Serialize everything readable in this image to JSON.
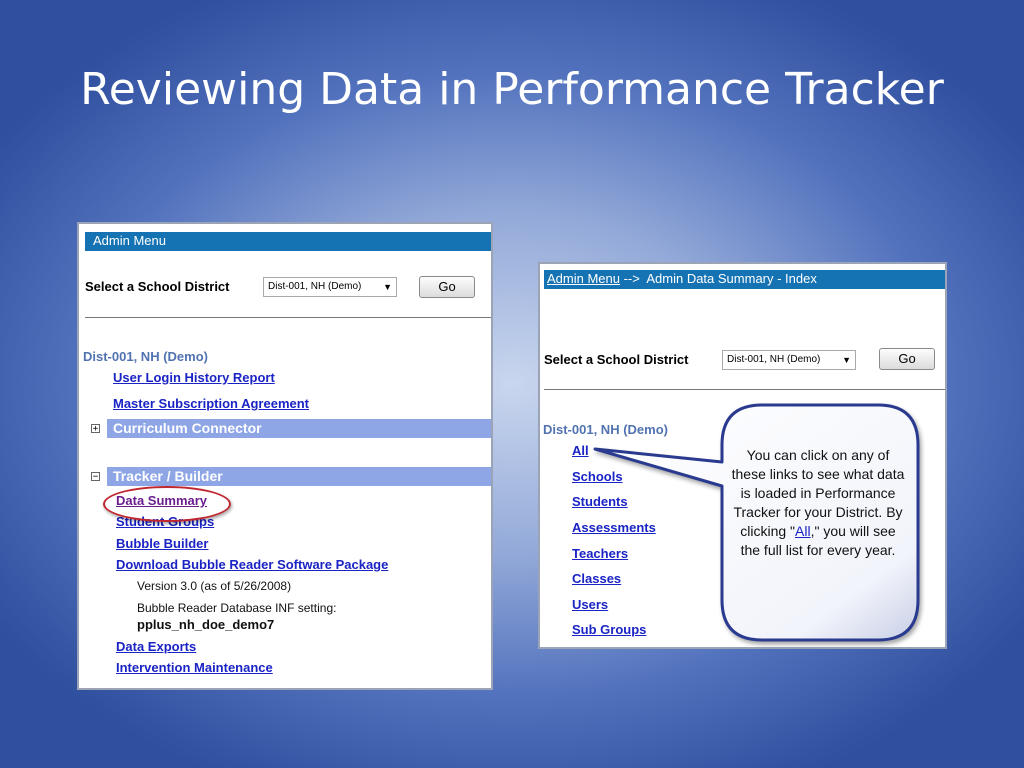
{
  "slide": {
    "title": "Reviewing Data in Performance Tracker"
  },
  "left_panel": {
    "header": "Admin Menu",
    "select_label": "Select a School District",
    "district_select_value": "Dist-001, NH (Demo)",
    "go_button": "Go",
    "district_name": "Dist-001, NH (Demo)",
    "links_top": [
      "User Login History Report",
      "Master Subscription Agreement"
    ],
    "section_curriculum": "Curriculum Connector",
    "section_tracker": "Tracker / Builder",
    "tracker_links": [
      "Data Summary",
      "Student Groups",
      "Bubble Builder",
      "Download Bubble Reader Software Package"
    ],
    "version_text": "Version 3.0 (as of 5/26/2008)",
    "inf_setting_label": "Bubble Reader Database INF setting:",
    "inf_setting_value": "pplus_nh_doe_demo7",
    "bottom_links": [
      "Data Exports",
      "Intervention Maintenance"
    ]
  },
  "right_panel": {
    "breadcrumb_link": "Admin Menu",
    "breadcrumb_rest": " -->  Admin Data Summary - Index",
    "select_label": "Select a School District",
    "district_select_value": "Dist-001, NH (Demo)",
    "go_button": "Go",
    "district_name": "Dist-001, NH (Demo)",
    "links": [
      "All",
      "Schools",
      "Students",
      "Assessments",
      "Teachers",
      "Classes",
      "Users",
      "Sub Groups"
    ]
  },
  "callout": {
    "text_before": "You can click on any of these links to see what data is loaded in Performance Tracker for your District. By clicking \"",
    "link_text": "All",
    "text_after": ",\" you will see the full list for every year."
  },
  "colors": {
    "header_bar": "#1673b3",
    "section_bar": "#8ea6e6",
    "link": "#1a23c4",
    "district_label": "#5173b0",
    "highlight_ring": "#c0262f",
    "callout_border": "#2a3a8f"
  }
}
